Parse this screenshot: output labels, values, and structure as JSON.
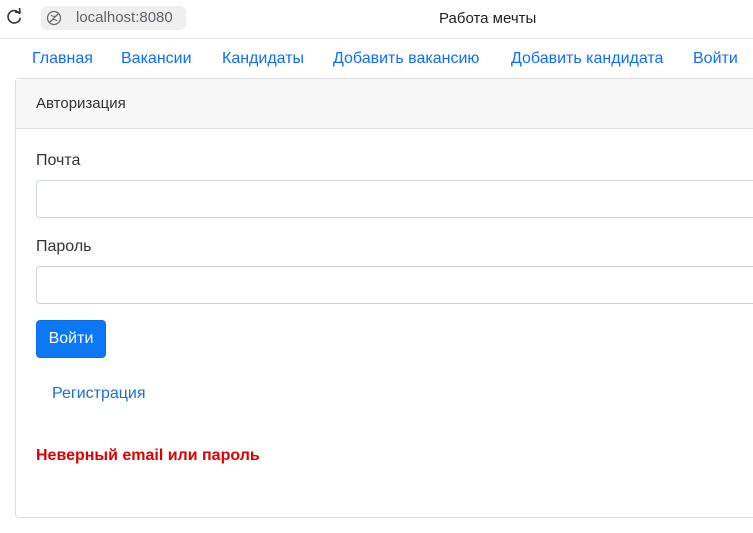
{
  "browser": {
    "url": "localhost:8080",
    "title": "Работа мечты"
  },
  "nav": {
    "items": [
      {
        "label": "Главная"
      },
      {
        "label": "Вакансии"
      },
      {
        "label": "Кандидаты"
      },
      {
        "label": "Добавить вакансию"
      },
      {
        "label": "Добавить кандидата"
      },
      {
        "label": "Войти"
      }
    ]
  },
  "auth": {
    "header": "Авторизация",
    "email_label": "Почта",
    "email_value": "",
    "password_label": "Пароль",
    "password_value": "",
    "submit_label": "Войти",
    "register_label": "Регистрация",
    "error_message": "Неверный email или пароль"
  },
  "colors": {
    "link": "#0d6efd",
    "primary_button": "#0d78f5",
    "error": "#e00000"
  },
  "icons": {
    "reload": "reload-icon",
    "site": "site-info-icon"
  }
}
